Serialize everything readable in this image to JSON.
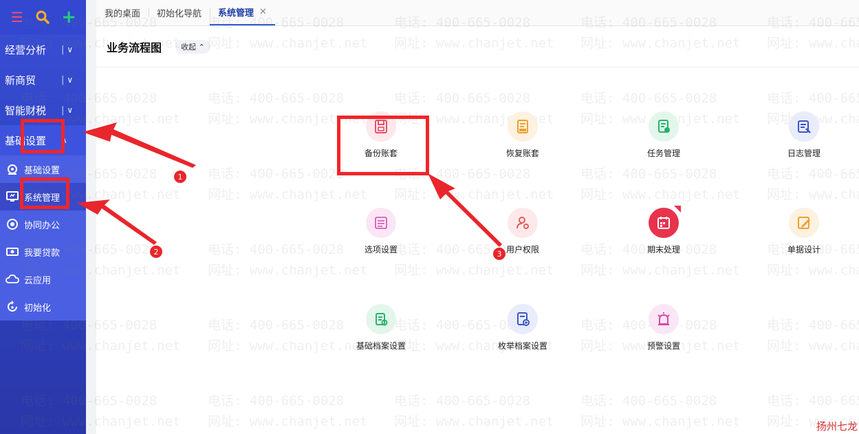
{
  "sidebar": {
    "icons": [
      "menu-icon",
      "search-icon",
      "plus-icon"
    ],
    "groups": [
      {
        "label": "经营分析",
        "sep": "|",
        "chev": "∨"
      },
      {
        "label": "新商贸",
        "sep": "|",
        "chev": "∨"
      },
      {
        "label": "智能财税",
        "sep": "|",
        "chev": "∨"
      },
      {
        "label": "基础设置",
        "chev": "∧"
      }
    ],
    "items": [
      {
        "label": "基础设置",
        "icon": "gear-icon"
      },
      {
        "label": "系统管理",
        "icon": "monitor-icon"
      },
      {
        "label": "协同办公",
        "icon": "collab-icon"
      },
      {
        "label": "我要贷款",
        "icon": "money-icon"
      },
      {
        "label": "云应用",
        "icon": "cloud-icon"
      },
      {
        "label": "初始化",
        "icon": "refresh-icon"
      }
    ]
  },
  "tabs": [
    {
      "label": "我的桌面"
    },
    {
      "label": "初始化导航"
    },
    {
      "label": "系统管理",
      "close": "✕"
    }
  ],
  "section": {
    "title": "业务流程图",
    "collapse": "收起 ⌃"
  },
  "tiles": [
    {
      "label": "备份账套",
      "icon": "backup-icon",
      "color": "#e8506a",
      "bg": "#fde8ec"
    },
    {
      "label": "恢复账套",
      "icon": "restore-icon",
      "color": "#f0a030",
      "bg": "#fdf1df"
    },
    {
      "label": "任务管理",
      "icon": "task-icon",
      "color": "#28b26a",
      "bg": "#e3f6ec"
    },
    {
      "label": "日志管理",
      "icon": "log-icon",
      "color": "#3a56c8",
      "bg": "#e8ecfb"
    },
    {
      "label": "选项设置",
      "icon": "options-icon",
      "color": "#d24ab0",
      "bg": "#fbe6f5"
    },
    {
      "label": "用户权限",
      "icon": "user-perm-icon",
      "color": "#e55a5a",
      "bg": "#fde9e9"
    },
    {
      "label": "期末处理",
      "icon": "period-end-icon",
      "color": "#ffffff",
      "bg": "#e8334d"
    },
    {
      "label": "单据设计",
      "icon": "doc-design-icon",
      "color": "#f0a030",
      "bg": "#fdf1df"
    },
    {
      "label": "基础档案设置",
      "icon": "archive-icon",
      "color": "#28b26a",
      "bg": "#e3f6ec"
    },
    {
      "label": "枚举档案设置",
      "icon": "enum-archive-icon",
      "color": "#3a56c8",
      "bg": "#e8ecfb"
    },
    {
      "label": "预警设置",
      "icon": "alarm-icon",
      "color": "#d24ab0",
      "bg": "#fbe6f5"
    }
  ],
  "watermark": {
    "line1": "电话: 400-665-0028",
    "line2": "网址: www.chanjet.net"
  },
  "annotations": [
    "1",
    "2",
    "3"
  ],
  "signature": "扬州七龙"
}
